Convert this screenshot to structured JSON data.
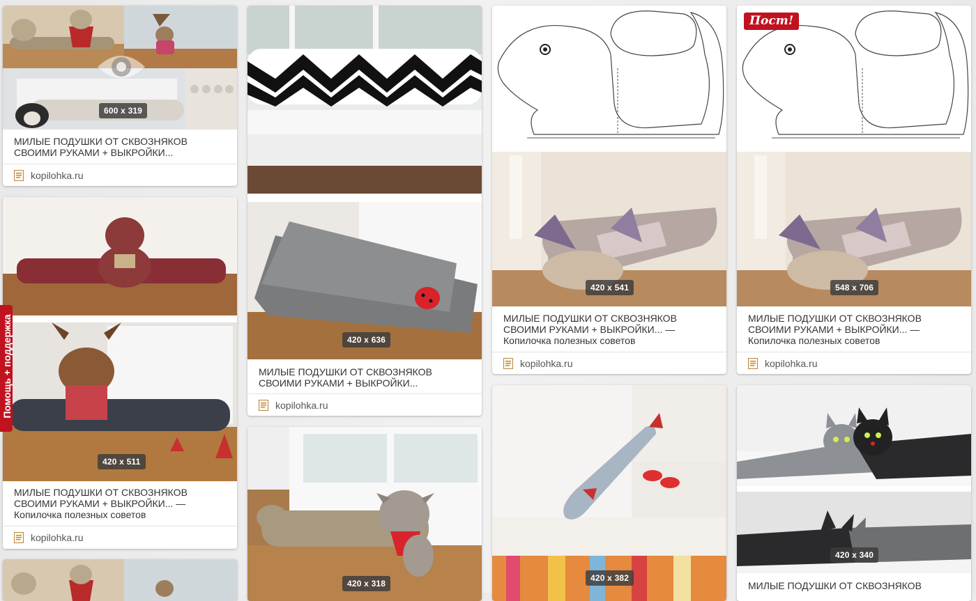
{
  "title_short": "МИЛЫЕ ПОДУШКИ ОТ СКВОЗНЯКОВ СВОИМИ РУКАМИ + ВЫКРОЙКИ...",
  "title_long": "МИЛЫЕ ПОДУШКИ ОТ СКВОЗНЯКОВ СВОИМИ РУКАМИ + ВЫКРОЙКИ... —",
  "subtitle": "Копилочка полезных советов",
  "title_cut": "МИЛЫЕ ПОДУШКИ ОТ СКВОЗНЯКОВ",
  "source": "kopilohka.ru",
  "post_label": "Пост!",
  "help_label": "Помощь + поддержка",
  "icons": {
    "eye": "eye-icon",
    "doc": "document-icon"
  },
  "colors": {
    "accent": "#c1121f",
    "badge": "#3c3c3c"
  },
  "cards": {
    "c1": {
      "size": "600 x 319"
    },
    "c2": {
      "size": "420 x 511"
    },
    "c3": {
      "size": "420 x 636"
    },
    "c4": {
      "size": "420 x 318"
    },
    "c5": {
      "size": "420 x 541"
    },
    "c6": {
      "size": "420 x 382"
    },
    "c7": {
      "size": "548 x 706"
    },
    "c8": {
      "size": "420 x 340"
    }
  }
}
